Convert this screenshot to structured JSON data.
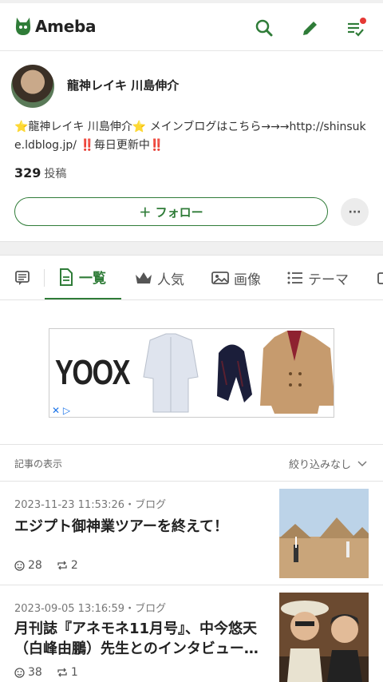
{
  "app": {
    "logo_text": "Ameba",
    "accent": "#2f7c38"
  },
  "header": {
    "icons": [
      "search-icon",
      "pencil-icon",
      "checklist-icon"
    ],
    "notification_dot": "#e53935"
  },
  "profile": {
    "name": "龍神レイキ 川島伸介",
    "bio": "⭐龍神レイキ 川島伸介⭐ メインブログはこちら→→→http://shinsuke.ldblog.jp/ ‼️毎日更新中‼️",
    "post_count": "329",
    "post_count_unit": "投稿",
    "follow_label": "＋ フォロー",
    "more_label": "···"
  },
  "tabs": [
    {
      "label": "",
      "icon": "message-icon"
    },
    {
      "label": "一覧",
      "icon": "document-icon",
      "active": true
    },
    {
      "label": "人気",
      "icon": "crown-icon"
    },
    {
      "label": "画像",
      "icon": "image-icon"
    },
    {
      "label": "テーマ",
      "icon": "list-icon"
    }
  ],
  "ad": {
    "brand": "YOOX"
  },
  "filter": {
    "label": "記事の表示",
    "value": "絞り込みなし"
  },
  "posts": [
    {
      "meta": "2023-11-23 11:53:26・ブログ",
      "title": "エジプト御神業ツアーを終えて！",
      "likes": "28",
      "reblogs": "2"
    },
    {
      "meta": "2023-09-05 13:16:59・ブログ",
      "title": "月刊誌『アネモネ11月号』、中今悠天（白峰由鵬）先生とのインタビュー…",
      "likes": "38",
      "reblogs": "1"
    }
  ]
}
